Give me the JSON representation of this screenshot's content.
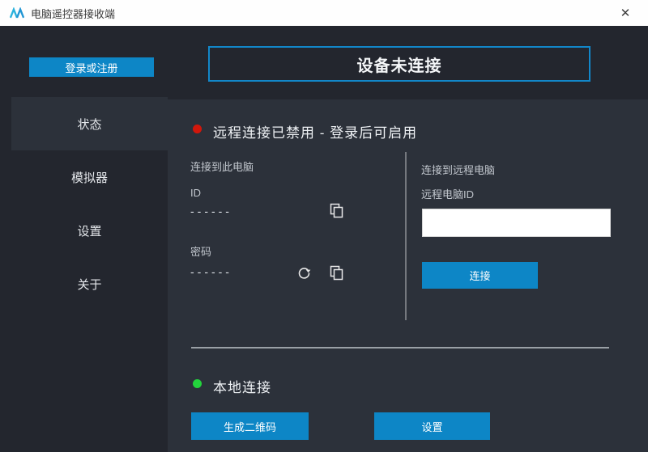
{
  "window": {
    "title": "电脑遥控器接收端",
    "close_glyph": "✕"
  },
  "header": {
    "login_button": "登录或注册",
    "device_status": "设备未连接"
  },
  "sidebar": {
    "items": [
      {
        "label": "状态",
        "selected": true
      },
      {
        "label": "模拟器",
        "selected": false
      },
      {
        "label": "设置",
        "selected": false
      },
      {
        "label": "关于",
        "selected": false
      }
    ]
  },
  "remote_section": {
    "status_header": "远程连接已禁用 - 登录后可启用",
    "status_color": "#d2170b",
    "this_pc": {
      "section_label": "连接到此电脑",
      "id_label": "ID",
      "id_value": "------",
      "password_label": "密码",
      "password_value": "------"
    },
    "remote_pc": {
      "section_label": "连接到远程电脑",
      "id_label": "远程电脑ID",
      "id_input_value": "",
      "connect_button": "连接"
    }
  },
  "local_section": {
    "header": "本地连接",
    "status_color": "#23d43c",
    "qr_button": "生成二维码",
    "settings_button": "设置"
  },
  "colors": {
    "accent": "#0d86c6",
    "panel": "#2c313a",
    "base": "#23262e"
  }
}
